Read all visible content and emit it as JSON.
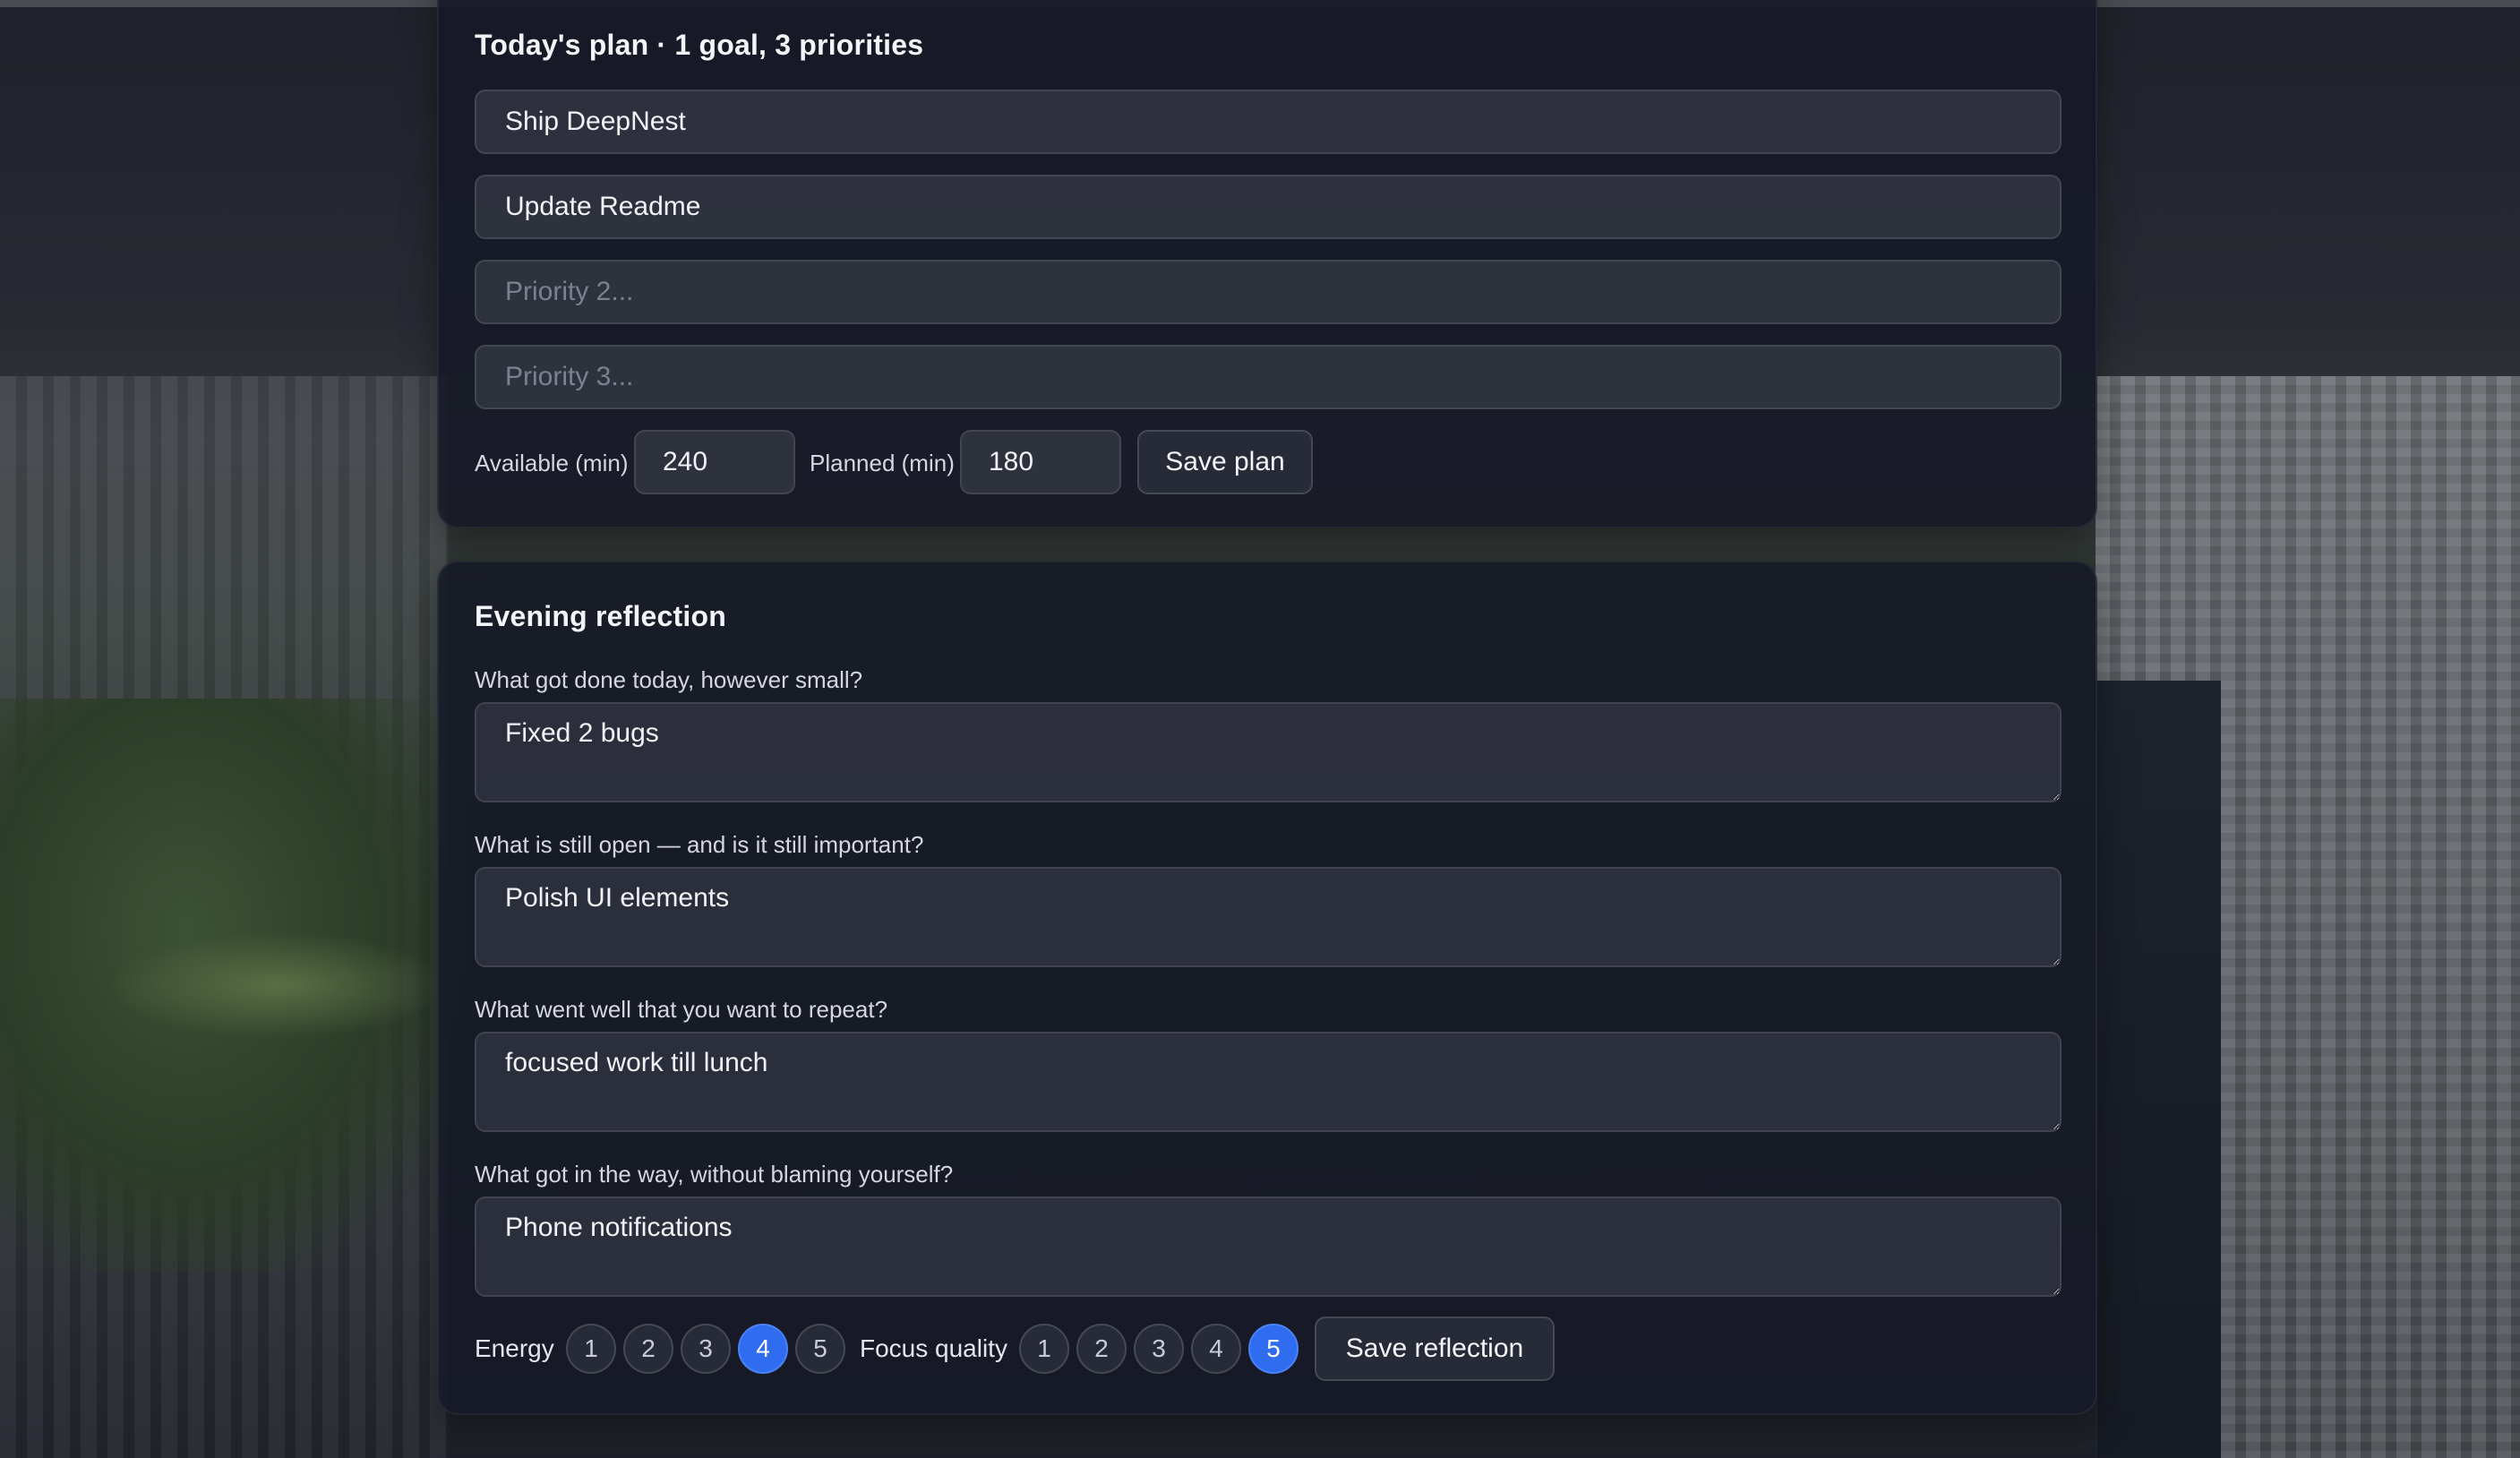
{
  "plan": {
    "title": "Today's plan · 1 goal, 3 priorities",
    "goal_value": "Ship DeepNest",
    "priority1_value": "Update Readme",
    "priority2_placeholder": "Priority 2...",
    "priority3_placeholder": "Priority 3...",
    "available_label": "Available (min)",
    "available_value": "240",
    "planned_label": "Planned (min)",
    "planned_value": "180",
    "save_label": "Save plan"
  },
  "reflection": {
    "title": "Evening reflection",
    "questions": [
      {
        "label": "What got done today, however small?",
        "value": "Fixed 2 bugs"
      },
      {
        "label": "What is still open — and is it still important?",
        "value": "Polish UI elements"
      },
      {
        "label": "What went well that you want to repeat?",
        "value": "focused work till lunch"
      },
      {
        "label": "What got in the way, without blaming yourself?",
        "value": "Phone notifications"
      }
    ],
    "energy_label": "Energy",
    "energy_options": [
      "1",
      "2",
      "3",
      "4",
      "5"
    ],
    "energy_selected": 4,
    "focus_label": "Focus quality",
    "focus_options": [
      "1",
      "2",
      "3",
      "4",
      "5"
    ],
    "focus_selected": 5,
    "save_label": "Save reflection"
  },
  "colors": {
    "accent": "#2f6cf0",
    "panel": "#161926"
  }
}
